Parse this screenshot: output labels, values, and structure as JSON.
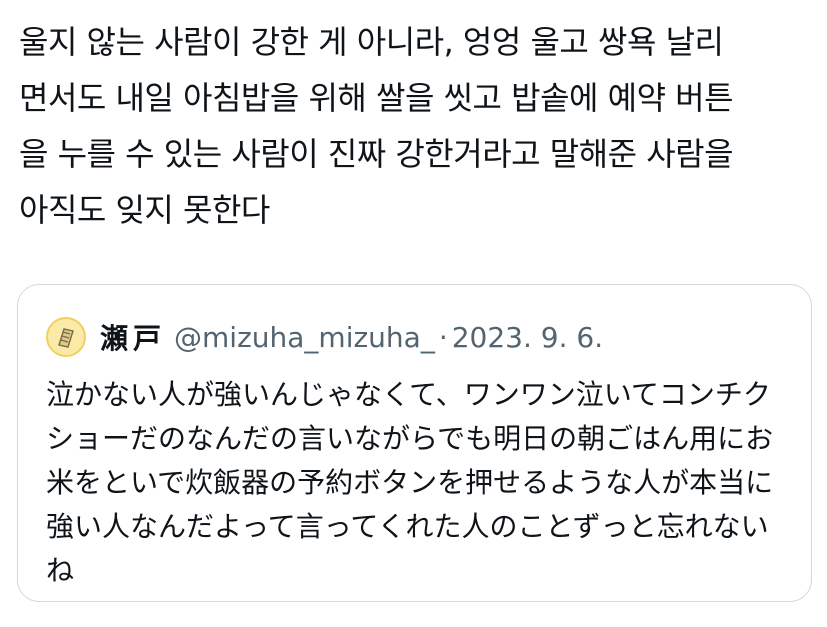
{
  "tweet": {
    "text_lines": [
      "울지 않는 사람이 강한 게 아니라, 엉엉 울고 쌍욕 날리",
      "면서도 내일 아침밥을 위해 쌀을 씻고 밥솥에 예약 버튼",
      "을 누를 수 있는 사람이 진짜 강한거라고 말해준 사람을",
      "아직도 잊지 못한다"
    ]
  },
  "quote": {
    "avatar_icon": "avatar-icon",
    "display_name": "瀬戸",
    "handle": "@mizuha_mizuha_",
    "separator": "·",
    "date": "2023. 9. 6.",
    "text_lines": [
      "泣かない人が強いんじゃなくて、ワンワン泣いてコンチク",
      "ショーだのなんだの言いながらでも明日の朝ごはん用にお",
      "米をといで炊飯器の予約ボタンを押せるような人が本当に",
      "強い人なんだよって言ってくれた人のことずっと忘れない",
      "ね"
    ]
  },
  "colors": {
    "text": "#0f1419",
    "secondary_text": "#536471",
    "border": "#cfd9de",
    "avatar_bg": "#fbe9a8"
  }
}
